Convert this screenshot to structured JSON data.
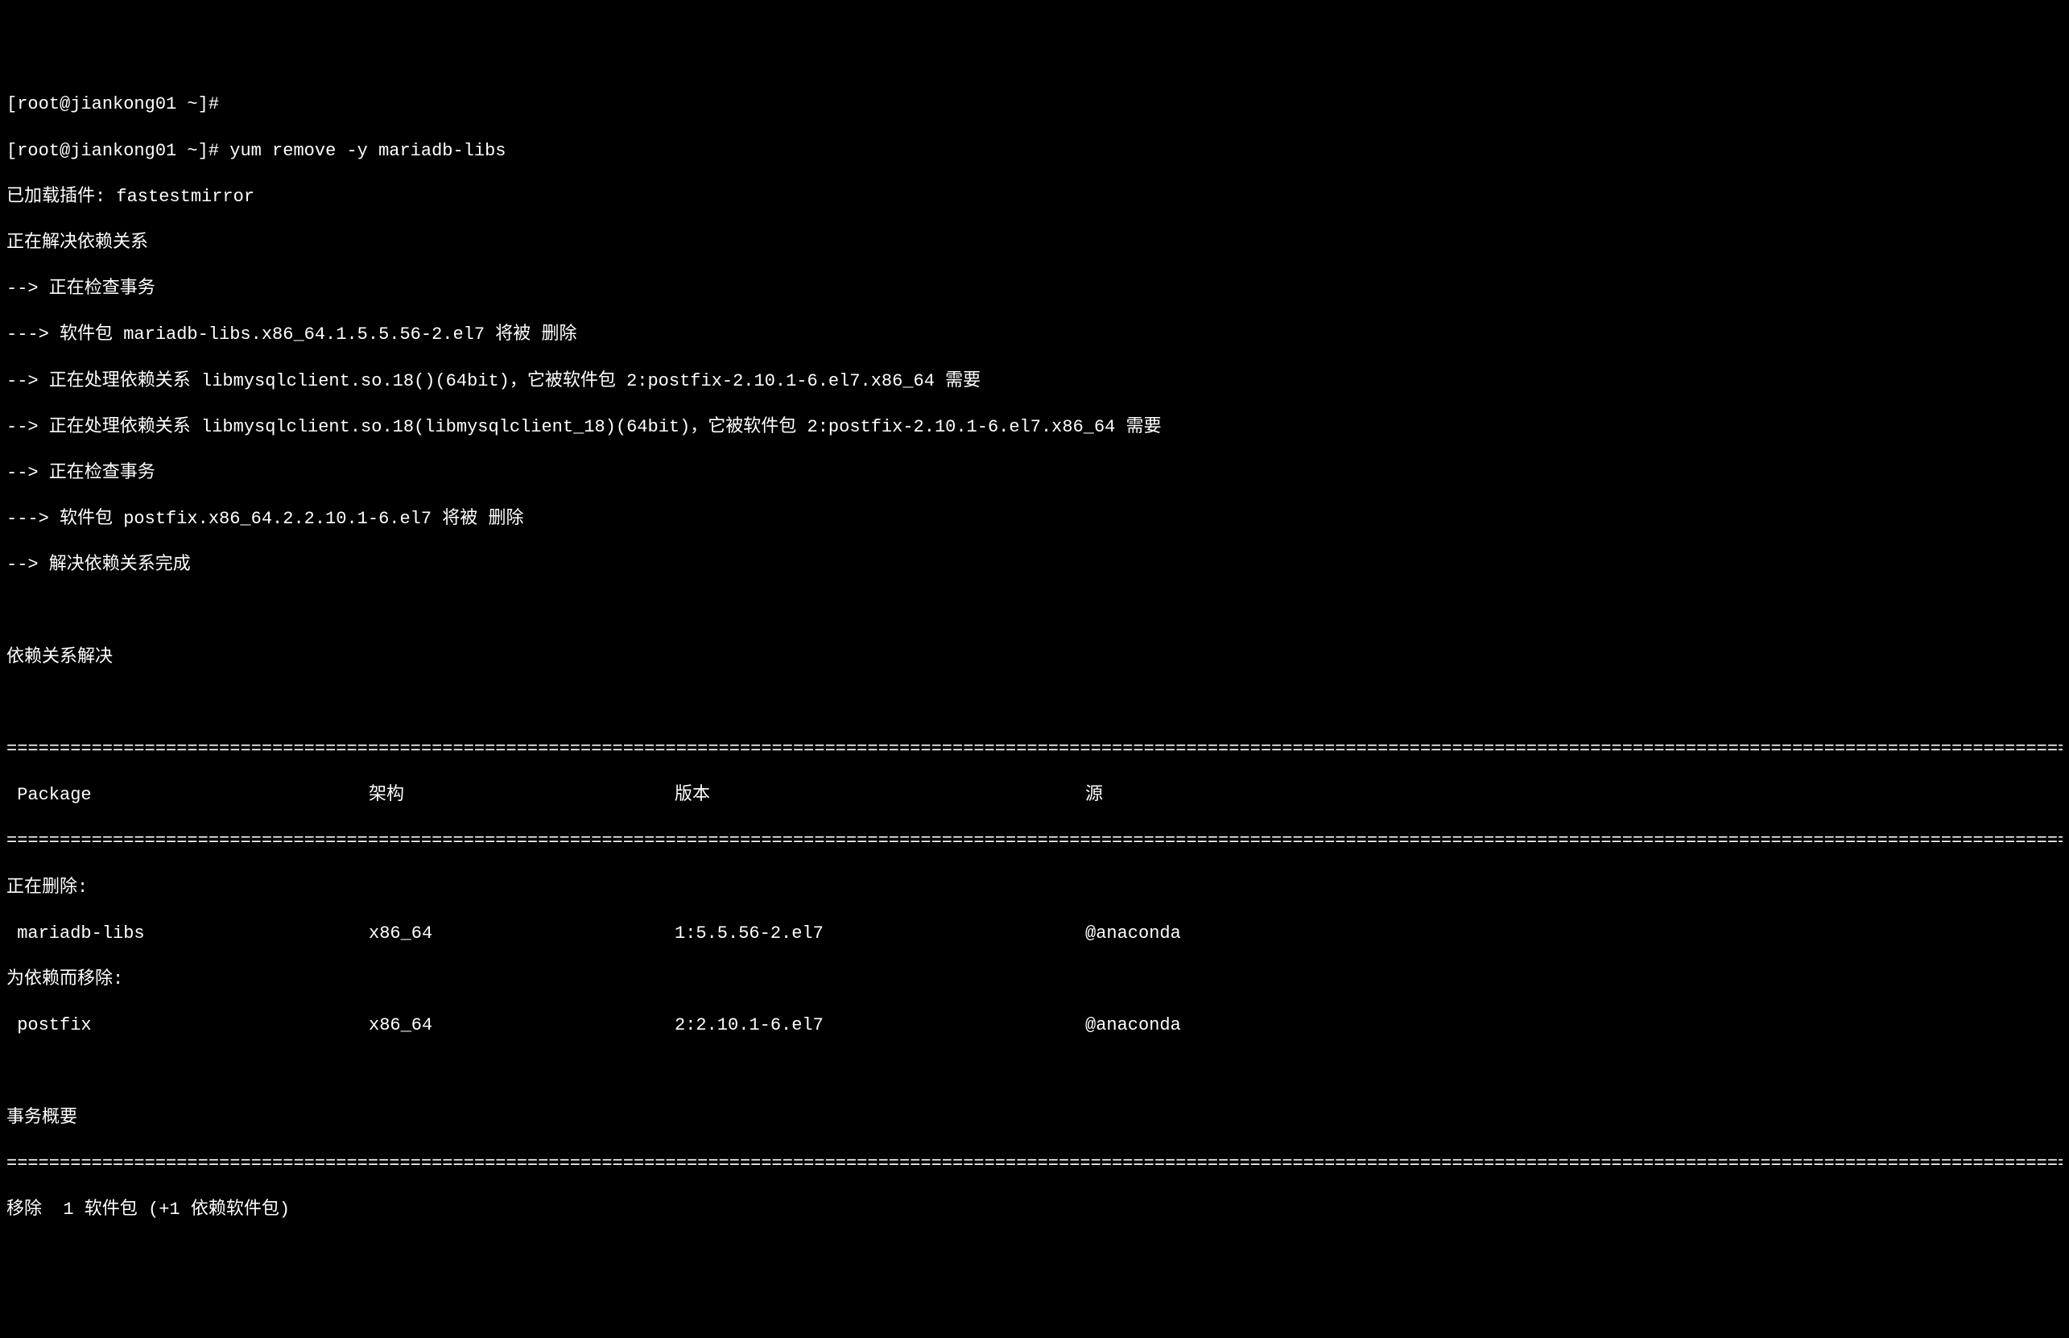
{
  "prompt1": "[root@jiankong01 ~]#",
  "prompt2": "[root@jiankong01 ~]# yum remove -y mariadb-libs",
  "output_lines": [
    "已加载插件: fastestmirror",
    "正在解决依赖关系",
    "--> 正在检查事务",
    "---> 软件包 mariadb-libs.x86_64.1.5.5.56-2.el7 将被 删除",
    "--> 正在处理依赖关系 libmysqlclient.so.18()(64bit)，它被软件包 2:postfix-2.10.1-6.el7.x86_64 需要",
    "--> 正在处理依赖关系 libmysqlclient.so.18(libmysqlclient_18)(64bit)，它被软件包 2:postfix-2.10.1-6.el7.x86_64 需要",
    "--> 正在检查事务",
    "---> 软件包 postfix.x86_64.2.2.10.1-6.el7 将被 删除",
    "--> 解决依赖关系完成"
  ],
  "deps_resolved": "依赖关系解决",
  "table": {
    "headers": {
      "package": " Package",
      "arch": "架构",
      "version": "版本",
      "source": "源"
    },
    "removing_label": "正在删除:",
    "removing_deps_label": "为依赖而移除:",
    "rows": [
      {
        "package": " mariadb-libs",
        "arch": "x86_64",
        "version": "1:5.5.56-2.el7",
        "source": "@anaconda"
      },
      {
        "package": " postfix",
        "arch": "x86_64",
        "version": "2:2.10.1-6.el7",
        "source": "@anaconda"
      }
    ]
  },
  "summary_label": "事务概要",
  "remove_summary": "移除  1 软件包 (+1 依赖软件包)",
  "divider": "=================================================================================================================================================================================================================================="
}
